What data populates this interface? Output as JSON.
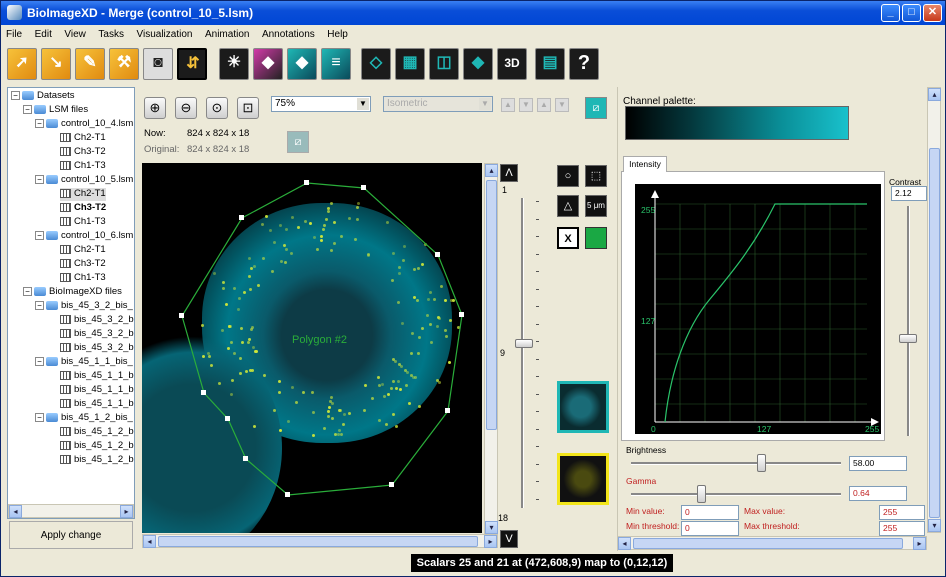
{
  "window": {
    "title": "BioImageXD - Merge (control_10_5.lsm)"
  },
  "menu": [
    "File",
    "Edit",
    "View",
    "Tasks",
    "Visualization",
    "Animation",
    "Annotations",
    "Help"
  ],
  "tree": {
    "root": "Datasets",
    "lsm_group": "LSM files",
    "files": [
      {
        "name": "control_10_4.lsm",
        "channels": [
          "Ch2-T1",
          "Ch3-T2",
          "Ch1-T3"
        ]
      },
      {
        "name": "control_10_5.lsm",
        "channels": [
          "Ch2-T1",
          "Ch3-T2",
          "Ch1-T3"
        ]
      },
      {
        "name": "control_10_6.lsm",
        "channels": [
          "Ch2-T1",
          "Ch3-T2",
          "Ch1-T3"
        ]
      }
    ],
    "bxd_group": "BioImageXD files",
    "bxd_files": [
      {
        "name": "bis_45_3_2_bis_",
        "items": [
          "bis_45_3_2_b",
          "bis_45_3_2_b",
          "bis_45_3_2_b"
        ]
      },
      {
        "name": "bis_45_1_1_bis_",
        "items": [
          "bis_45_1_1_b",
          "bis_45_1_1_b",
          "bis_45_1_1_b"
        ]
      },
      {
        "name": "bis_45_1_2_bis_",
        "items": [
          "bis_45_1_2_b",
          "bis_45_1_2_b",
          "bis_45_1_2_b"
        ]
      }
    ],
    "apply_label": "Apply change"
  },
  "viewer": {
    "zoom": "75%",
    "mode": "Isometric",
    "now_label": "Now:",
    "now_value": "824 x 824 x 18",
    "original_label": "Original:",
    "original_value": "824 x 824 x 18",
    "polygon_label": "Polygon #2",
    "slice_min": "1",
    "slice_cur": "9",
    "slice_max": "18",
    "scale_label": "5 μm"
  },
  "right": {
    "palette_label": "Channel palette:",
    "tab_label": "Intensity",
    "contrast_label": "Contrast",
    "contrast_value": "2.12",
    "y_top": "255",
    "y_mid": "127",
    "x_min": "0",
    "x_mid": "127",
    "x_max": "255",
    "brightness_label": "Brightness",
    "brightness_value": "58.00",
    "gamma_label": "Gamma",
    "gamma_value": "0.64",
    "min_value_label": "Min value:",
    "min_value": "0",
    "max_value_label": "Max value:",
    "max_value": "255",
    "min_threshold_label": "Min threshold:",
    "min_threshold": "0",
    "max_threshold_label": "Max threshold:",
    "max_threshold": "255"
  },
  "status": "Scalars 25 and 21 at (472,608,9) map to (0,12,12)"
}
